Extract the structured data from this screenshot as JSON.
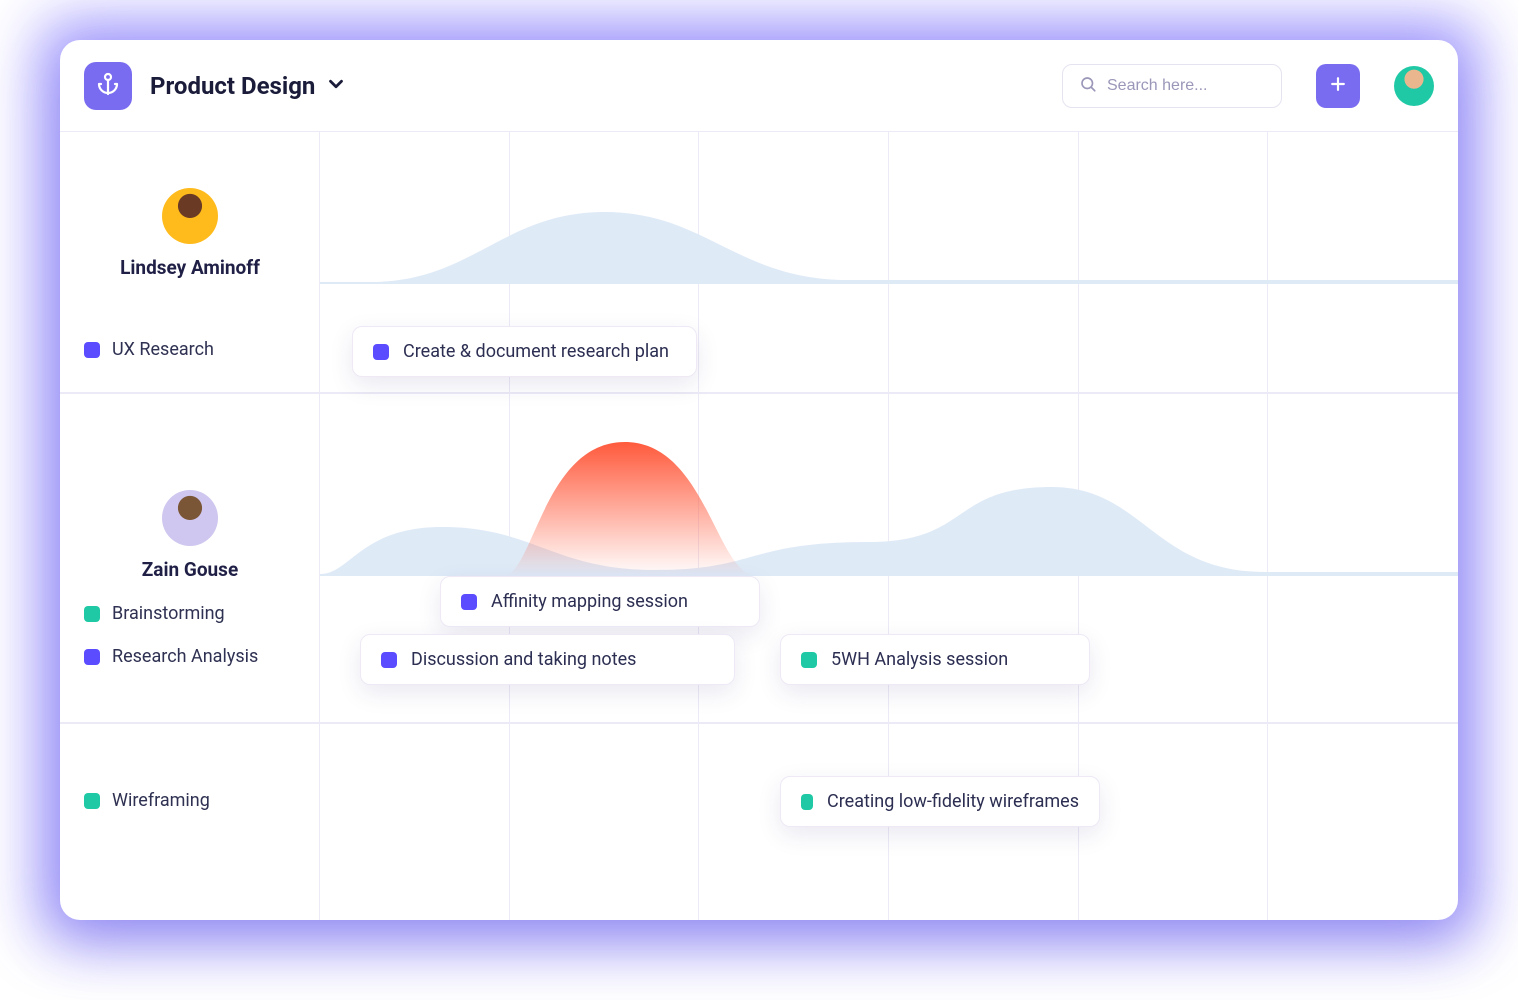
{
  "header": {
    "project_title": "Product Design",
    "search_placeholder": "Search here...",
    "team_avatar_colors": [
      "#f6d2a8",
      "#20c9a6",
      "#f7b733",
      "#2bb6f6"
    ],
    "me_avatar_color": "#20c9a6"
  },
  "colors": {
    "purple": "#5b4cff",
    "teal": "#20c9a6"
  },
  "people": [
    {
      "name": "Lindsey Aminoff",
      "avatar_bg": "#ffbb1c"
    },
    {
      "name": "Zain Gouse",
      "avatar_bg": "#cfc7ef"
    }
  ],
  "categories": {
    "ux_research": {
      "label": "UX Research",
      "color": "purple"
    },
    "brainstorming": {
      "label": "Brainstorming",
      "color": "teal"
    },
    "research_analysis": {
      "label": "Research Analysis",
      "color": "purple"
    },
    "wireframing": {
      "label": "Wireframing",
      "color": "teal"
    }
  },
  "tasks": {
    "t1": {
      "label": "Create & document research plan",
      "color": "purple"
    },
    "t2": {
      "label": "Affinity mapping session",
      "color": "purple"
    },
    "t3": {
      "label": "Discussion and taking notes",
      "color": "purple"
    },
    "t4": {
      "label": "5WH Analysis session",
      "color": "teal"
    },
    "t5": {
      "label": "Creating low-fidelity wireframes",
      "color": "teal"
    }
  }
}
